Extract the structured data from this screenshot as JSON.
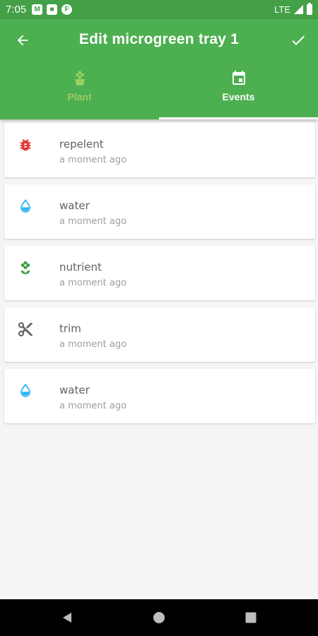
{
  "status_bar": {
    "time": "7:05",
    "network": "LTE"
  },
  "app_bar": {
    "title": "Edit microgreen tray 1"
  },
  "tabs": [
    {
      "label": "Plant",
      "icon": "flower-pot-icon",
      "active": false
    },
    {
      "label": "Events",
      "icon": "calendar-icon",
      "active": true
    }
  ],
  "events": [
    {
      "name": "repelent",
      "time": "a moment ago",
      "icon": "bug-icon",
      "color": "#e53935"
    },
    {
      "name": "water",
      "time": "a moment ago",
      "icon": "water-drop-icon",
      "color": "#29b6f6"
    },
    {
      "name": "nutrient",
      "time": "a moment ago",
      "icon": "flower-icon",
      "color": "#43a047"
    },
    {
      "name": "trim",
      "time": "a moment ago",
      "icon": "scissors-icon",
      "color": "#616161"
    },
    {
      "name": "water",
      "time": "a moment ago",
      "icon": "water-drop-icon",
      "color": "#29b6f6"
    }
  ],
  "colors": {
    "primary": "#4caf50",
    "primary_dark": "#43a047",
    "inactive_tab": "#9ccc65"
  }
}
